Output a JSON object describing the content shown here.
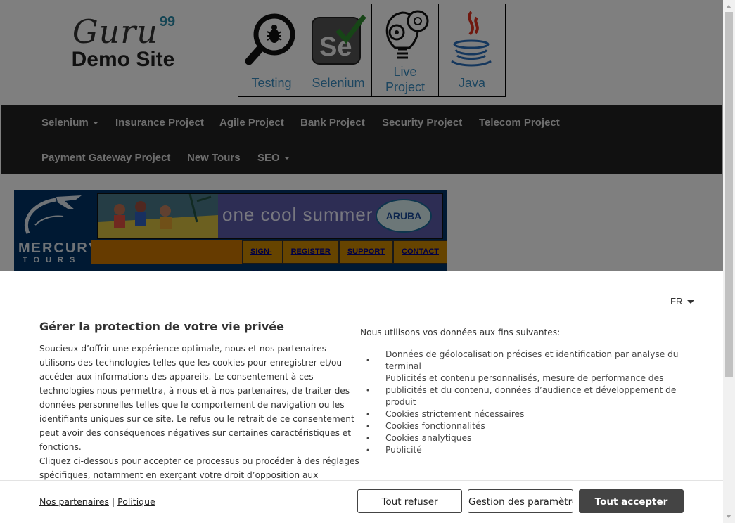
{
  "header": {
    "logo_main": "Guru",
    "logo_sup": "99",
    "logo_sub": "Demo Site",
    "tiles": [
      {
        "label": "Testing",
        "icon": "magnifier-bug-icon"
      },
      {
        "label": "Selenium",
        "icon": "selenium-logo-icon"
      },
      {
        "label": "Live Project",
        "icon": "lightbulb-gears-icon"
      },
      {
        "label": "Java",
        "icon": "java-cup-icon"
      }
    ]
  },
  "nav": {
    "row1": [
      "Selenium",
      "Insurance Project",
      "Agile Project",
      "Bank Project",
      "Security Project",
      "Telecom Project"
    ],
    "row2": [
      "Payment Gateway Project",
      "New Tours",
      "SEO"
    ]
  },
  "mercury": {
    "brand_line1": "MERCURY",
    "brand_line2": "TOURS",
    "ad_text": "one cool summer",
    "ad_badge": "ARUBA",
    "links": [
      "SIGN-ON",
      "REGISTER",
      "SUPPORT",
      "CONTACT"
    ]
  },
  "consent": {
    "language": "FR",
    "title": "Gérer la protection de votre vie privée",
    "body_p1": "Soucieux d’offrir une expérience optimale, nous et nos partenaires utilisons des technologies telles que les cookies pour enregistrer et/ou accéder aux informations des appareils. Le consentement à ces technologies nous permettra, à nous et à nos partenaires, de traiter des données personnelles telles que le comportement de navigation ou les identifiants uniques sur ce site. Le refus ou le retrait de ce consentement peut avoir des conséquences négatives sur certaines caractéristiques et fonctions.",
    "body_p2": "Cliquez ci-dessous pour accepter ce processus ou procéder à des réglages spécifiques, notamment en exerçant votre droit d’opposition aux entreprises qui traitent des données personnelles sur la base d’un intérêt",
    "purposes_intro": "Nous utilisons vos données aux fins suivantes:",
    "purposes": [
      "Données de géolocalisation précises et identification par analyse du terminal",
      "Publicités et contenu personnalisés, mesure de performance des publicités et du contenu, données d’audience et développement de produit",
      "Cookies strictement nécessaires",
      "Cookies fonctionnalités",
      "Cookies analytiques",
      "Publicité"
    ],
    "link_partners": "Nos partenaires",
    "link_separator": "|",
    "link_policy": "Politique",
    "btn_refuse": "Tout refuser",
    "btn_params": "Gestion des paramètres",
    "btn_accept": "Tout accepter"
  }
}
